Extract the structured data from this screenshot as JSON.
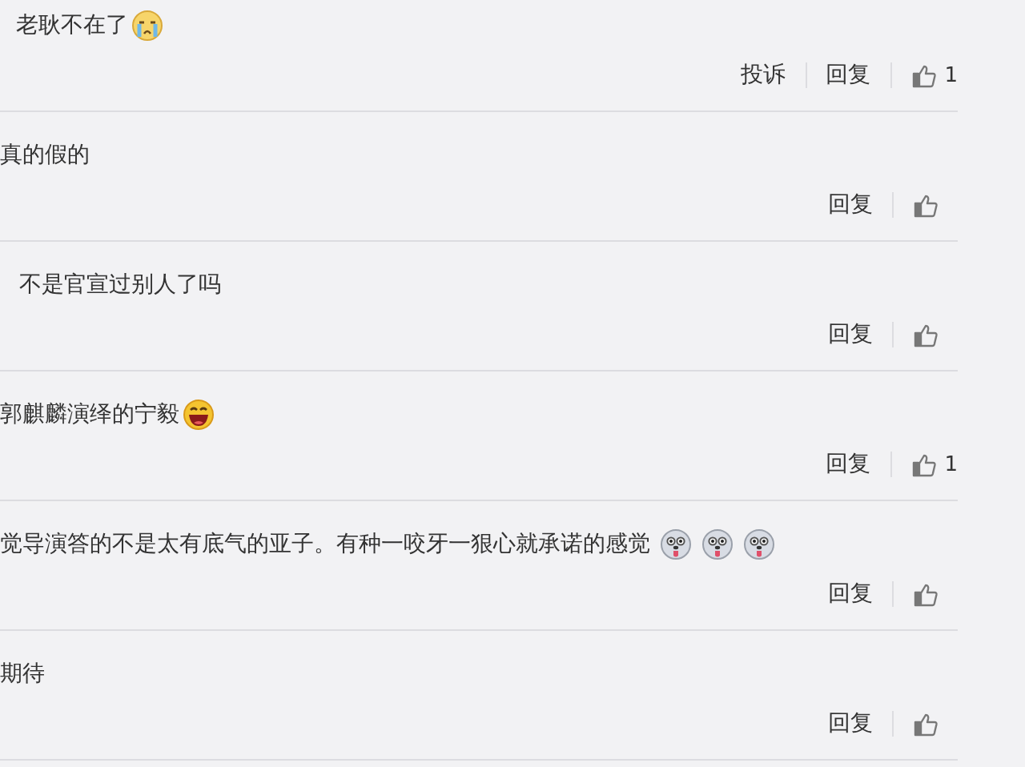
{
  "comments": [
    {
      "text": "老耿不在了",
      "emojis": [
        {
          "kind": "crying"
        }
      ],
      "report": "投诉",
      "reply": "回复",
      "likes": "1"
    },
    {
      "text": "真的假的",
      "reply": "回复"
    },
    {
      "text": "不是官宣过别人了吗",
      "reply": "回复"
    },
    {
      "text": "郭麒麟演绎的宁毅",
      "emojis": [
        {
          "kind": "laughing"
        }
      ],
      "reply": "回复",
      "likes": "1"
    },
    {
      "text": "觉导演答的不是太有底气的亚子。有种一咬牙一狠心就承诺的感觉",
      "emojis": [
        {
          "kind": "dog"
        },
        {
          "kind": "dog"
        },
        {
          "kind": "dog"
        }
      ],
      "reply": "回复"
    },
    {
      "text": "期待",
      "reply": "回复"
    }
  ]
}
